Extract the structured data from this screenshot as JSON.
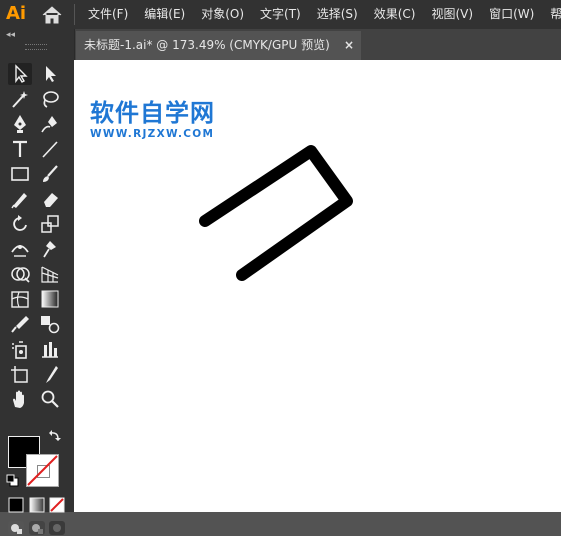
{
  "app": {
    "logo_text": "Ai",
    "accent_color": "#FF9A00"
  },
  "menubar": {
    "items": [
      "文件(F)",
      "编辑(E)",
      "对象(O)",
      "文字(T)",
      "选择(S)",
      "效果(C)",
      "视图(V)",
      "窗口(W)",
      "帮助("
    ]
  },
  "document_tab": {
    "label": "未标题-1.ai* @ 173.49% (CMYK/GPU 预览)",
    "close_label": "×"
  },
  "toolbar": {
    "collapse_label": "◂◂"
  },
  "watermark": {
    "title": "软件自学网",
    "url": "WWW.RJZXW.COM",
    "color": "#1f77d4"
  },
  "canvas": {
    "background": "#FFFFFF",
    "stroke_color": "#000000"
  },
  "colors": {
    "fill": "#000000",
    "stroke": "none"
  }
}
